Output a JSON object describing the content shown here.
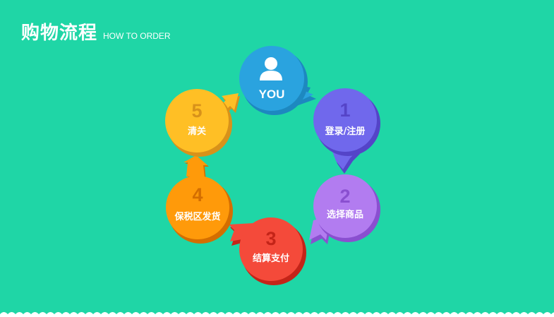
{
  "header": {
    "title": "购物流程",
    "subtitle": "HOW TO ORDER"
  },
  "start": {
    "label": "YOU",
    "icon": "user-icon",
    "color": "#2aa3df"
  },
  "steps": [
    {
      "num": "1",
      "label": "登录/注册",
      "color": "#7068ec",
      "num_color": "#5544c8"
    },
    {
      "num": "2",
      "label": "选择商品",
      "color": "#b27cf0",
      "num_color": "#8a4fd0"
    },
    {
      "num": "3",
      "label": "结算支付",
      "color": "#f44a3a",
      "num_color": "#c42418"
    },
    {
      "num": "4",
      "label": "保税区发货",
      "color": "#ff9a0a",
      "num_color": "#d46e00"
    },
    {
      "num": "5",
      "label": "清关",
      "color": "#ffbf25",
      "num_color": "#d8921a"
    }
  ],
  "colors": {
    "background": "#1fd6a6",
    "text": "#ffffff"
  }
}
